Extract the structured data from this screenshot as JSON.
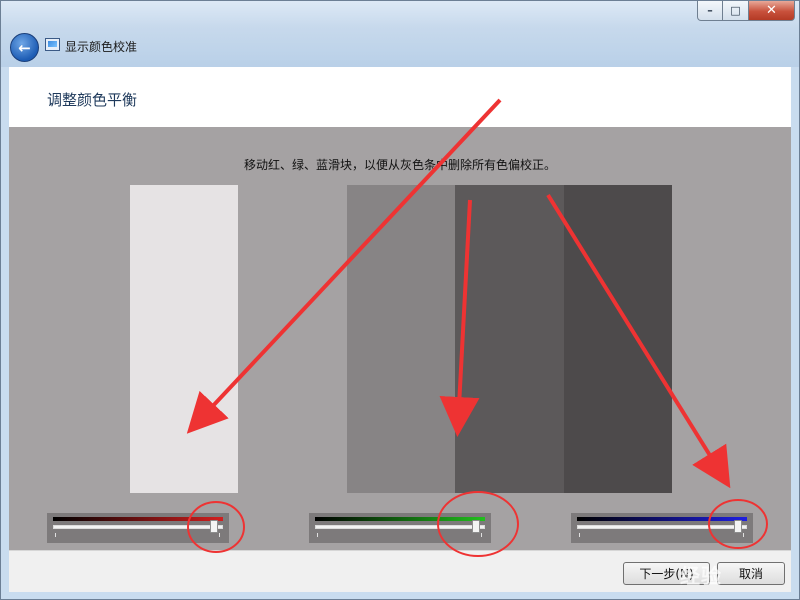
{
  "window": {
    "title": "显示颜色校准",
    "controls": {
      "minimize": "–",
      "maximize": "□",
      "close": "✕"
    },
    "back_icon": "back-arrow-icon"
  },
  "header": {
    "heading": "调整颜色平衡"
  },
  "content": {
    "instruction": "移动红、绿、蓝滑块，以便从灰色条中删除所有色偏校正。",
    "gray_bars": [
      "#e6e3e4",
      "#a5a2a3",
      "#878485",
      "#5c595a",
      "#4d4a4b"
    ]
  },
  "sliders": [
    {
      "name": "red",
      "color": "#d21f1f",
      "value": 0.97
    },
    {
      "name": "green",
      "color": "#22c01e",
      "value": 0.97
    },
    {
      "name": "blue",
      "color": "#1f1fe0",
      "value": 0.97
    }
  ],
  "footer": {
    "next_label": "下一步(N)",
    "cancel_label": "取消"
  },
  "annotation": {
    "color": "#ee3333"
  },
  "watermark": {
    "text": "经验"
  }
}
